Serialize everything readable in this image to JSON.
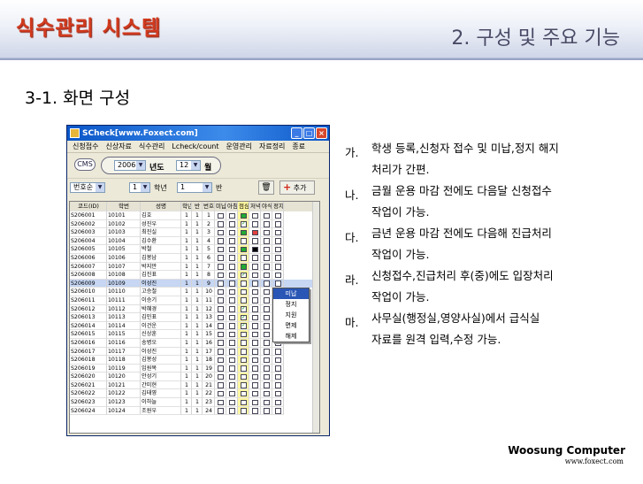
{
  "slide": {
    "title": "식수관리 시스템",
    "section": "2. 구성 및 주요 기능",
    "subsection": "3-1. 화면 구성"
  },
  "window": {
    "title": "SCheck[www.Foxect.com]",
    "menu": [
      "신청접수",
      "신상자료",
      "식수관리",
      "Lcheck/count",
      "운영관리",
      "자료정리",
      "종료"
    ],
    "cms_label": "CMS",
    "year": "2006",
    "year_label": "년도",
    "month": "12",
    "month_label": "월",
    "sort_combo": "번호순",
    "grade_combo": "1",
    "grade_label": "학년",
    "class_combo": "1",
    "class_label": "반",
    "add_label": "추가",
    "columns": [
      "코드(ID)",
      "학번",
      "성명",
      "학년",
      "반",
      "번호",
      "미납",
      "아침",
      "점심",
      "저녁",
      "야식",
      "정지"
    ],
    "rows": [
      {
        "code": "S206001",
        "no": "10101",
        "name": "김호",
        "grade": "1",
        "cls": "1",
        "num": "1",
        "checks": [
          "",
          "",
          "g",
          "",
          "",
          ""
        ]
      },
      {
        "code": "S206002",
        "no": "10102",
        "name": "성진우",
        "grade": "1",
        "cls": "1",
        "num": "2",
        "checks": [
          "",
          "",
          "v",
          "",
          "",
          ""
        ]
      },
      {
        "code": "S206003",
        "no": "10103",
        "name": "최진실",
        "grade": "1",
        "cls": "1",
        "num": "3",
        "checks": [
          "",
          "",
          "g",
          "r",
          "",
          ""
        ]
      },
      {
        "code": "S206004",
        "no": "10104",
        "name": "김수환",
        "grade": "1",
        "cls": "1",
        "num": "4",
        "checks": [
          "",
          "",
          "",
          "",
          "",
          ""
        ]
      },
      {
        "code": "S206005",
        "no": "10105",
        "name": "박철",
        "grade": "1",
        "cls": "1",
        "num": "5",
        "checks": [
          "",
          "",
          "g",
          "k",
          "",
          ""
        ]
      },
      {
        "code": "S206006",
        "no": "10106",
        "name": "김봉남",
        "grade": "1",
        "cls": "1",
        "num": "6",
        "checks": [
          "",
          "",
          "",
          "",
          "",
          ""
        ]
      },
      {
        "code": "S206007",
        "no": "10107",
        "name": "박지만",
        "grade": "1",
        "cls": "1",
        "num": "7",
        "checks": [
          "",
          "",
          "g",
          "",
          "",
          ""
        ]
      },
      {
        "code": "S206008",
        "no": "10108",
        "name": "김진표",
        "grade": "1",
        "cls": "1",
        "num": "8",
        "checks": [
          "",
          "",
          "v",
          "",
          "",
          ""
        ]
      },
      {
        "code": "S206009",
        "no": "10109",
        "name": "이성진",
        "grade": "1",
        "cls": "1",
        "num": "9",
        "checks": [
          "",
          "",
          "",
          "",
          "",
          ""
        ]
      },
      {
        "code": "S206010",
        "no": "10110",
        "name": "고승철",
        "grade": "1",
        "cls": "1",
        "num": "10",
        "checks": [
          "",
          "",
          "",
          "",
          "",
          ""
        ]
      },
      {
        "code": "S206011",
        "no": "10111",
        "name": "이승기",
        "grade": "1",
        "cls": "1",
        "num": "11",
        "checks": [
          "",
          "",
          "",
          "",
          "",
          ""
        ]
      },
      {
        "code": "S206012",
        "no": "10112",
        "name": "박혜경",
        "grade": "1",
        "cls": "1",
        "num": "12",
        "checks": [
          "",
          "",
          "v",
          "",
          "",
          ""
        ]
      },
      {
        "code": "S206013",
        "no": "10113",
        "name": "김민표",
        "grade": "1",
        "cls": "1",
        "num": "13",
        "checks": [
          "",
          "",
          "v",
          "",
          "",
          ""
        ]
      },
      {
        "code": "S206014",
        "no": "10114",
        "name": "이건운",
        "grade": "1",
        "cls": "1",
        "num": "14",
        "checks": [
          "",
          "",
          "v",
          "",
          "",
          ""
        ]
      },
      {
        "code": "S206015",
        "no": "10115",
        "name": "신상훈",
        "grade": "1",
        "cls": "1",
        "num": "15",
        "checks": [
          "",
          "",
          "",
          "",
          "",
          ""
        ]
      },
      {
        "code": "S206016",
        "no": "10116",
        "name": "송병오",
        "grade": "1",
        "cls": "1",
        "num": "16",
        "checks": [
          "",
          "",
          "",
          "",
          "",
          ""
        ]
      },
      {
        "code": "S206017",
        "no": "10117",
        "name": "이성진",
        "grade": "1",
        "cls": "1",
        "num": "17",
        "checks": [
          "",
          "",
          "",
          "",
          "",
          ""
        ]
      },
      {
        "code": "S206018",
        "no": "10118",
        "name": "김봉성",
        "grade": "1",
        "cls": "1",
        "num": "18",
        "checks": [
          "",
          "",
          "",
          "",
          "",
          ""
        ]
      },
      {
        "code": "S206019",
        "no": "10119",
        "name": "임원목",
        "grade": "1",
        "cls": "1",
        "num": "19",
        "checks": [
          "",
          "",
          "",
          "",
          "",
          ""
        ]
      },
      {
        "code": "S206020",
        "no": "10120",
        "name": "안성기",
        "grade": "1",
        "cls": "1",
        "num": "20",
        "checks": [
          "",
          "",
          "",
          "",
          "",
          ""
        ]
      },
      {
        "code": "S206021",
        "no": "10121",
        "name": "간미현",
        "grade": "1",
        "cls": "1",
        "num": "21",
        "checks": [
          "",
          "",
          "",
          "",
          "",
          ""
        ]
      },
      {
        "code": "S206022",
        "no": "10122",
        "name": "김태영",
        "grade": "1",
        "cls": "1",
        "num": "22",
        "checks": [
          "",
          "",
          "",
          "",
          "",
          ""
        ]
      },
      {
        "code": "S206023",
        "no": "10123",
        "name": "이하늘",
        "grade": "1",
        "cls": "1",
        "num": "23",
        "checks": [
          "",
          "",
          "",
          "",
          "",
          ""
        ]
      },
      {
        "code": "S206024",
        "no": "10124",
        "name": "조원우",
        "grade": "1",
        "cls": "1",
        "num": "24",
        "checks": [
          "",
          "",
          "",
          "",
          "",
          ""
        ]
      }
    ],
    "selected_row": 8,
    "context_menu": [
      "미납",
      "정지",
      "지원",
      "면제",
      "해제"
    ],
    "context_active": 0
  },
  "features": [
    {
      "key": "가.",
      "lines": [
        "학생 등록,신청자 접수 및 미납,정지 해지",
        "처리가 간편."
      ]
    },
    {
      "key": "나.",
      "lines": [
        "금월 운용 마감 전에도 다음달 신청접수",
        "작업이 가능."
      ]
    },
    {
      "key": "다.",
      "lines": [
        "금년 운용 마감 전에도 다음해 진급처리",
        "작업이 가능."
      ]
    },
    {
      "key": "라.",
      "lines": [
        "신청접수,진급처리 후(중)에도 입장처리",
        "작업이 가능."
      ]
    },
    {
      "key": "마.",
      "lines": [
        "사무실(행정실,영양사실)에서  급식실",
        "자료를 원격 입력,수정 가능."
      ]
    }
  ],
  "footer": {
    "company": "Woosung Computer",
    "url": "www.foxect.com"
  }
}
